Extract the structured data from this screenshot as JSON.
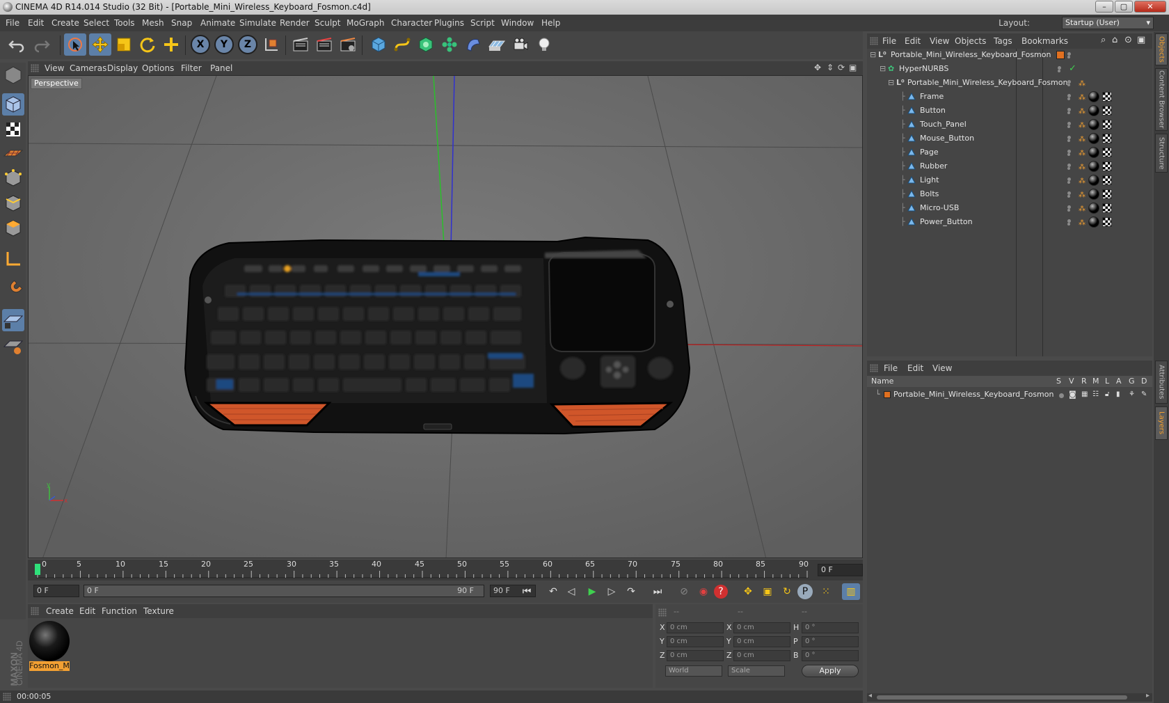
{
  "window": {
    "title": "CINEMA 4D R14.014 Studio (32 Bit) - [Portable_Mini_Wireless_Keyboard_Fosmon.c4d]",
    "controls": [
      "minimize-icon",
      "restore-icon",
      "close-icon"
    ]
  },
  "menubar": {
    "items": [
      "File",
      "Edit",
      "Create",
      "Select",
      "Tools",
      "Mesh",
      "Snap",
      "Animate",
      "Simulate",
      "Render",
      "Sculpt",
      "MoGraph",
      "Character",
      "Plugins",
      "Script",
      "Window",
      "Help"
    ],
    "layout_label": "Layout:",
    "layout_value": "Startup (User)"
  },
  "toolbar": {
    "icons": [
      "undo-icon",
      "redo-icon",
      "live-selection-icon",
      "move-icon",
      "scale-icon",
      "rotate-icon",
      "add-icon",
      "x-axis-icon",
      "y-axis-icon",
      "z-axis-icon",
      "coordinate-system-icon",
      "render-view-icon",
      "render-picture-viewer-icon",
      "render-settings-icon",
      "cube-icon",
      "spline-icon",
      "nurbs-icon",
      "array-icon",
      "deformer-icon",
      "floor-icon",
      "camera-icon",
      "light-icon"
    ],
    "axis_labels": [
      "X",
      "Y",
      "Z"
    ]
  },
  "viewport": {
    "menu": [
      "View",
      "Cameras",
      "Display",
      "Options",
      "Filter",
      "Panel"
    ],
    "label": "Perspective"
  },
  "timeline": {
    "ticks": [
      "0",
      "5",
      "10",
      "15",
      "20",
      "25",
      "30",
      "35",
      "40",
      "45",
      "50",
      "55",
      "60",
      "65",
      "70",
      "75",
      "80",
      "85",
      "90"
    ],
    "current_frame": "0 F"
  },
  "transport": {
    "start": "0 F",
    "range_start": "0 F",
    "range_end": "90 F",
    "end": "90 F"
  },
  "material_manager": {
    "menu": [
      "Create",
      "Edit",
      "Function",
      "Texture"
    ],
    "material_name": "Fosmon_M"
  },
  "coordinates": {
    "headers": [
      "--",
      "--",
      "--"
    ],
    "rows": [
      {
        "pos_label": "X",
        "pos": "0 cm",
        "size_label": "X",
        "size": "0 cm",
        "rot_label": "H",
        "rot": "0 °"
      },
      {
        "pos_label": "Y",
        "pos": "0 cm",
        "size_label": "Y",
        "size": "0 cm",
        "rot_label": "P",
        "rot": "0 °"
      },
      {
        "pos_label": "Z",
        "pos": "0 cm",
        "size_label": "Z",
        "size": "0 cm",
        "rot_label": "B",
        "rot": "0 °"
      }
    ],
    "mode1": "World",
    "mode2": "Scale",
    "apply": "Apply"
  },
  "status": {
    "time": "00:00:05"
  },
  "brand": {
    "maxon": "MAXON",
    "cinema": "CINEMA 4D"
  },
  "object_manager": {
    "menu": [
      "File",
      "Edit",
      "View",
      "Objects",
      "Tags",
      "Bookmarks"
    ],
    "objects": [
      {
        "name": "Portable_Mini_Wireless_Keyboard_Fosmon",
        "type": "null"
      },
      {
        "name": "HyperNURBS",
        "type": "hypernurbs"
      },
      {
        "name": "Portable_Mini_Wireless_Keyboard_Fosmon",
        "type": "null"
      },
      {
        "name": "Frame",
        "type": "polygon"
      },
      {
        "name": "Button",
        "type": "polygon"
      },
      {
        "name": "Touch_Panel",
        "type": "polygon"
      },
      {
        "name": "Mouse_Button",
        "type": "polygon"
      },
      {
        "name": "Page",
        "type": "polygon"
      },
      {
        "name": "Rubber",
        "type": "polygon"
      },
      {
        "name": "Light",
        "type": "polygon"
      },
      {
        "name": "Bolts",
        "type": "polygon"
      },
      {
        "name": "Micro-USB",
        "type": "polygon"
      },
      {
        "name": "Power_Button",
        "type": "polygon"
      }
    ]
  },
  "layer_manager": {
    "menu": [
      "File",
      "Edit",
      "View"
    ],
    "columns": [
      "Name",
      "S",
      "V",
      "R",
      "M",
      "L",
      "A",
      "G",
      "D"
    ],
    "layers": [
      {
        "name": "Portable_Mini_Wireless_Keyboard_Fosmon",
        "color": "#e07020"
      }
    ]
  },
  "right_tabs": [
    "Objects",
    "Content Browser",
    "Structure",
    "Attributes",
    "Layers"
  ],
  "colors": {
    "accent_orange": "#f2a033",
    "selection_blue": "#5c7fa8",
    "viewport_bg": "#6a6a6a"
  }
}
